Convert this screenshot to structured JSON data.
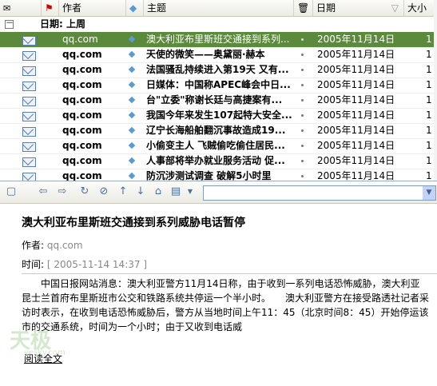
{
  "columns": {
    "from": "作者",
    "subject": "主题",
    "date": "日期",
    "size": "大小"
  },
  "group": {
    "toggle": "－",
    "label": "日期: 上周"
  },
  "messages": [
    {
      "from": "qq.com",
      "subject": "澳大利亚布里斯班交通接到系列...",
      "date": "2005年11月14日",
      "size": "1"
    },
    {
      "from": "qq.com",
      "subject": "天使的微笑——奥黛丽·赫本",
      "date": "2005年11月14日",
      "size": "1 K"
    },
    {
      "from": "qq.com",
      "subject": "法国骚乱持续进入第19天 又有...",
      "date": "2005年11月14日",
      "size": "1 K"
    },
    {
      "from": "qq.com",
      "subject": "日媒体：中国称APEC峰会中日...",
      "date": "2005年11月14日",
      "size": "1 K"
    },
    {
      "from": "qq.com",
      "subject": "台\"立委\"称谢长廷与高捷案有...",
      "date": "2005年11月14日",
      "size": "1 K"
    },
    {
      "from": "qq.com",
      "subject": "我国今年来发生107起特大安全...",
      "date": "2005年11月14日",
      "size": "1 K"
    },
    {
      "from": "qq.com",
      "subject": "辽宁长海船舶翻沉事故造成19...",
      "date": "2005年11月14日",
      "size": "1 K"
    },
    {
      "from": "qq.com",
      "subject": "小偷变主人 飞贼偷吃偷住居民...",
      "date": "2005年11月14日",
      "size": "1 K"
    },
    {
      "from": "qq.com",
      "subject": "人事部将举办就业服务活动 促...",
      "date": "2005年11月14日",
      "size": "1 K"
    },
    {
      "from": "qq.com",
      "subject": "防沉涉测试调查 破解5小时里",
      "date": "2005年11月14日",
      "size": "1 K"
    }
  ],
  "article": {
    "title": "澳大利亚布里斯班交通接到系列威胁电话暂停",
    "author_label": "作者:",
    "author": "qq.com",
    "time_label": "时间:",
    "time": "[ 2005-11-14 14:37 ]",
    "body": "中国日报网站消息：澳大利亚警方11月14日称，由于收到一系列电话恐怖威胁，澳大利亚昆士兰首府布里斯班市公交和铁路系统共停运一个半小时。　　澳大利亚警方在接受路透社记者采访时表示，在收到电话恐怖威胁后，警方从当地时间上午11：45（北京时间8：45）开始停运该市的交通系统，时间为一个小时；由于又收到电话威",
    "read_more": "阅读全文"
  },
  "watermark": {
    "text": "天极",
    "sub": "yesky.com"
  },
  "colors": {
    "selected_row": "#5b8a3c",
    "accent": "#4a6fa5"
  }
}
